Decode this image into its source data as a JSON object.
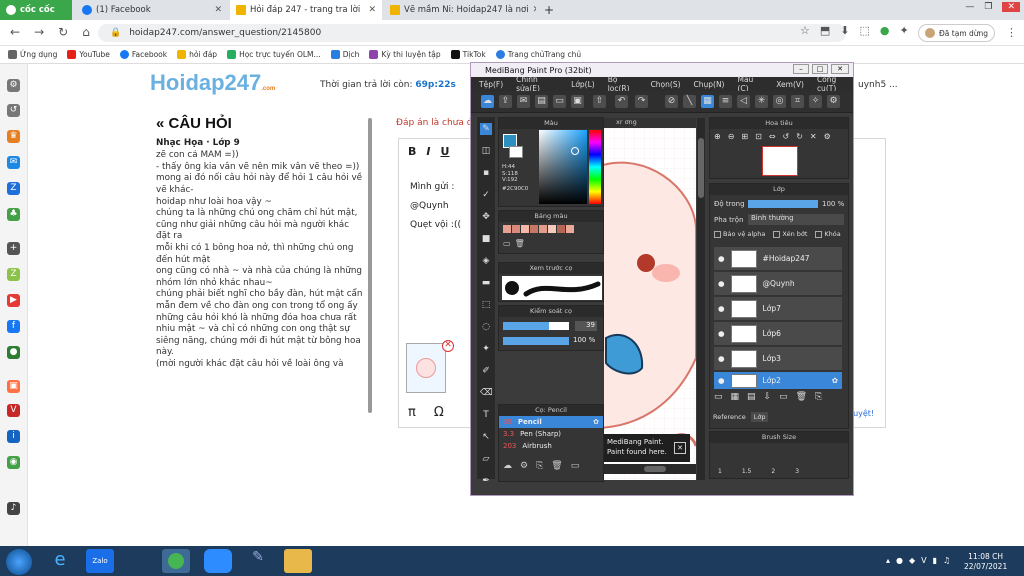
{
  "tabs": [
    {
      "label": "cốc cốc",
      "color": "#3aa84a"
    },
    {
      "label": "(1) Facebook",
      "color": "#1877f2"
    },
    {
      "label": "Hỏi đáp 247 - trang tra lời",
      "color": "#f0b400"
    },
    {
      "label": "Vẽ mầm Ni: Hoidap247 là nơi",
      "color": "#f0b400"
    }
  ],
  "address": {
    "url": "hoidap247.com/answer_question/2145800",
    "profile": "Đã tạm dừng"
  },
  "bookmarks": [
    "Ứng dụng",
    "YouTube",
    "Facebook",
    "hỏi đáp",
    "Học trực tuyến OLM...",
    "Dịch",
    "Kỳ thi luyện tập",
    "TikTok",
    "Trang chủTrang chủ"
  ],
  "page": {
    "logo": "Hoidap247",
    "logo_sub": ".com",
    "timer_label": "Thời gian trả lời còn:",
    "timer_value": "69p:22s",
    "user_fragment": "uynh5 ...",
    "question_heading": "« CÂU HỎI",
    "question_subject": "Nhạc Họa · Lớp 9",
    "question_text": "zẽ con cả MĂM =))\n- thấy ông kia vân vẽ nên mik vân vẽ theo =))\nmong ai đó nối câu hỏi này để hỏi 1 câu hỏi về vẽ khác-\nhoidap như loài hoa vậy ~\nchúng ta là những chú ong chăm chỉ hút mật, cũng như giải những câu  hỏi mà người khác đặt ra\nmỗi khi có 1 bông hoa nở, thì những chú ong đến hút mật\nong cũng có nhà ~ và nhà của chúng là những nhóm lớn nhỏ khác nhau~\nchúng phải biết nghĩ cho bầy đàn, hút mật cẩn mẫn đem về cho đàn ong con trong tổ ong ấy\nnhững câu hỏi khó là những đóa hoa chưa rất nhiu mật ~ và chỉ có những con ong thật sự siêng năng, chúng mới đi hút mật từ bông hoa này.\n(mời người khác đặt câu hỏi về loài ông và",
    "answer_note": "Đáp án là chưa đ",
    "answer_lines": [
      "Mình gửi :",
      "@Quynh",
      "Quẹt vội :(("
    ],
    "verify_link": "duyệt!",
    "fmt_buttons": [
      "B",
      "I",
      "U"
    ],
    "bottom_tools": [
      "π",
      "Ω"
    ]
  },
  "medibang": {
    "title": "MediBang Paint Pro (32bit)",
    "menu": [
      "Tệp(F)",
      "Chỉnh sửa(E)",
      "Lớp(L)",
      "Bộ lọc(R)",
      "Chọn(S)",
      "Chụp(N)",
      "Màu (C)",
      "Xem(V)",
      "Công cụ(T)"
    ],
    "color_panel": {
      "title": "Màu",
      "hex": "#2C90C0",
      "hsv": "H:44\nS:118\nV:192",
      "primary": "#2C90C0"
    },
    "palette_title": "Bảng màu",
    "preview_title": "Xem trước cọ",
    "brush_ctrl_title": "Kiểm soát cọ",
    "brush_size": "39",
    "brush_opacity": "100 %",
    "brush_list_title": "Cọ: Pencil",
    "brushes": [
      {
        "size": "39",
        "name": "Pencil",
        "selected": true
      },
      {
        "size": "3.3",
        "name": "Pen (Sharp)",
        "selected": false
      },
      {
        "size": "203",
        "name": "Airbrush",
        "selected": false
      }
    ],
    "canvas_tab": "xr ơng",
    "tooltip": "MediBang Paint.\nPaint found here.",
    "nav_title": "Hoa tiêu",
    "layer_title": "Lớp",
    "opacity_label": "Độ trong",
    "opacity_value": "100 %",
    "blend_label": "Pha trộn",
    "blend_value": "Bình thường",
    "checks": [
      "Bảo vệ alpha",
      "Xén bớt",
      "Khóa"
    ],
    "layers": [
      {
        "name": "#Hoidap247",
        "selected": false
      },
      {
        "name": "@Quynh",
        "selected": false
      },
      {
        "name": "Lớp7",
        "selected": false
      },
      {
        "name": "Lớp6",
        "selected": false
      },
      {
        "name": "Lớp3",
        "selected": false
      },
      {
        "name": "Lớp2",
        "selected": true
      }
    ],
    "layer_tabs": [
      "Reference",
      "Lớp"
    ],
    "brush_size_title": "Brush Size",
    "brush_sizes": [
      "1",
      "1.5",
      "2",
      "3"
    ]
  },
  "taskbar": {
    "time": "11:08 CH",
    "date": "22/07/2021"
  }
}
